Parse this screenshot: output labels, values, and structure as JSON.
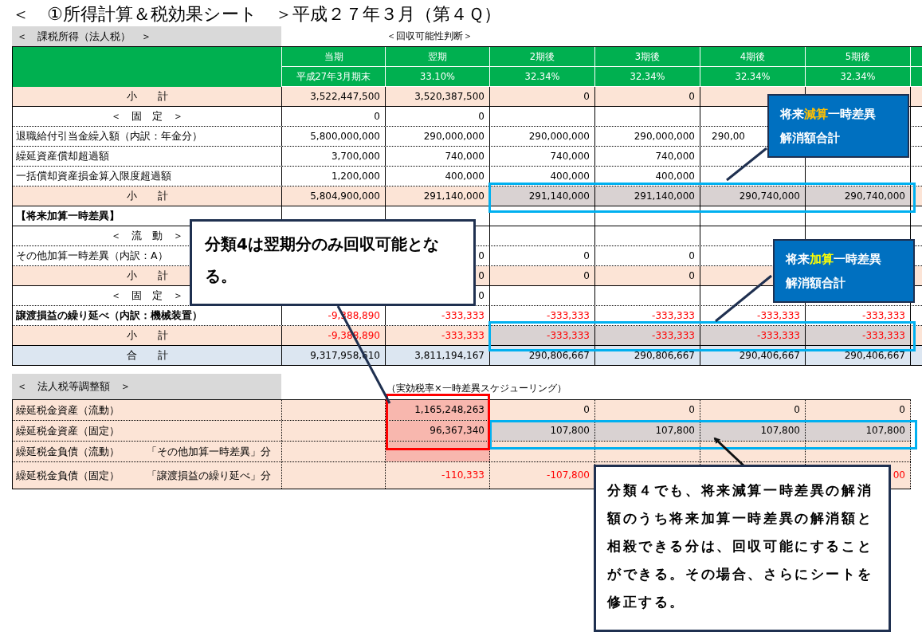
{
  "title": "＜　①所得計算＆税効果シート　＞平成２７年３月（第４Ｑ）",
  "upper": {
    "heading": "＜　課税所得（法人税）　＞",
    "note": "＜回収可能性判断＞",
    "columns": [
      {
        "period": "当期",
        "rate": "平成27年3月期末"
      },
      {
        "period": "翌期",
        "rate": "33.10%"
      },
      {
        "period": "2期後",
        "rate": "32.34%"
      },
      {
        "period": "3期後",
        "rate": "32.34%"
      },
      {
        "period": "4期後",
        "rate": "32.34%"
      },
      {
        "period": "5期後",
        "rate": "32.34%"
      }
    ],
    "rows": [
      {
        "kind": "subtotal",
        "label": "小　　計",
        "bold": false,
        "cells": [
          {
            "value": "3,522,447,500"
          },
          {
            "value": "3,520,387,500"
          },
          {
            "value": "0"
          },
          {
            "value": "0"
          },
          {},
          {}
        ]
      },
      {
        "kind": "group",
        "label": "＜　固　定　＞",
        "bold": false,
        "cells": [
          {
            "value": "0"
          },
          {
            "value": "0"
          },
          {},
          {},
          {},
          {}
        ]
      },
      {
        "kind": "item",
        "label": "退職給付引当金繰入額（内訳：年金分）",
        "bold": false,
        "cells": [
          {
            "value": "5,800,000,000"
          },
          {
            "value": "290,000,000"
          },
          {
            "value": "290,000,000"
          },
          {
            "value": "290,000,000"
          },
          {
            "value": "290,00",
            "cut": true
          },
          {}
        ]
      },
      {
        "kind": "item",
        "label": "繰延資産償却超過額",
        "bold": false,
        "cells": [
          {
            "value": "3,700,000"
          },
          {
            "value": "740,000"
          },
          {
            "value": "740,000"
          },
          {
            "value": "740,000"
          },
          {},
          {}
        ]
      },
      {
        "kind": "item",
        "label": "一括償却資産損金算入限度超過額",
        "bold": false,
        "cells": [
          {
            "value": "1,200,000"
          },
          {
            "value": "400,000"
          },
          {
            "value": "400,000"
          },
          {
            "value": "400,000"
          },
          {},
          {}
        ]
      },
      {
        "kind": "subtotal",
        "label": "小　　計",
        "bold": false,
        "cells": [
          {
            "value": "5,804,900,000"
          },
          {
            "value": "291,140,000"
          },
          {
            "value": "291,140,000",
            "shaded": true
          },
          {
            "value": "291,140,000",
            "shaded": true
          },
          {
            "value": "290,740,000",
            "shaded": true
          },
          {
            "value": "290,740,000",
            "shaded": true
          }
        ]
      },
      {
        "kind": "section",
        "label": "【将来加算一時差異】",
        "bold": true,
        "cells": [
          {},
          {},
          {},
          {},
          {},
          {}
        ]
      },
      {
        "kind": "group",
        "label": "＜　流　動　＞",
        "bold": false,
        "cells": [
          {},
          {},
          {},
          {},
          {},
          {}
        ]
      },
      {
        "kind": "item",
        "label": "その他加算一時差異（内訳：A）",
        "bold": false,
        "cells": [
          {},
          {
            "value": "0"
          },
          {
            "value": "0"
          },
          {
            "value": "0"
          },
          {},
          {}
        ]
      },
      {
        "kind": "subtotal",
        "label": "小　　計",
        "bold": false,
        "cells": [
          {},
          {
            "value": "0"
          },
          {
            "value": "0"
          },
          {
            "value": "0"
          },
          {},
          {}
        ]
      },
      {
        "kind": "group",
        "label": "＜　固　定　＞",
        "bold": false,
        "cells": [
          {},
          {
            "value": "0"
          },
          {},
          {},
          {},
          {}
        ]
      },
      {
        "kind": "item",
        "label": "譲渡損益の繰り延べ（内訳：機械装置）",
        "bold": true,
        "negative": true,
        "cells": [
          {
            "value": "-9,388,890"
          },
          {
            "value": "-333,333"
          },
          {
            "value": "-333,333"
          },
          {
            "value": "-333,333"
          },
          {
            "value": "-333,333"
          },
          {
            "value": "-333,333"
          }
        ]
      },
      {
        "kind": "subtotal",
        "label": "小　　計",
        "bold": false,
        "negative": true,
        "cells": [
          {
            "value": "-9,388,890"
          },
          {
            "value": "-333,333"
          },
          {
            "value": "-333,333",
            "shaded": true
          },
          {
            "value": "-333,333",
            "shaded": true
          },
          {
            "value": "-333,333",
            "shaded": true
          },
          {
            "value": "-333,333",
            "shaded": true
          }
        ]
      },
      {
        "kind": "total",
        "label": "合　　計",
        "bold": false,
        "cells": [
          {
            "value": "9,317,958,610"
          },
          {
            "value": "3,811,194,167"
          },
          {
            "value": "290,806,667"
          },
          {
            "value": "290,806,667"
          },
          {
            "value": "290,406,667"
          },
          {
            "value": "290,406,667"
          }
        ]
      }
    ]
  },
  "lower": {
    "heading": "＜　法人税等調整額　＞",
    "note": "（実効税率×一時差異スケジューリング）",
    "rows": [
      {
        "label": "繰延税金資産（流動）",
        "cells": [
          {},
          {
            "value": "1,165,248,263",
            "flagged": true
          },
          {
            "value": "0"
          },
          {
            "value": "0"
          },
          {
            "value": "0"
          },
          {
            "value": "0"
          }
        ]
      },
      {
        "label": "繰延税金資産（固定）",
        "cells": [
          {},
          {
            "value": "96,367,340",
            "flagged": true
          },
          {
            "value": "107,800",
            "shaded": true
          },
          {
            "value": "107,800",
            "shaded": true
          },
          {
            "value": "107,800",
            "shaded": true
          },
          {
            "value": "107,800",
            "shaded": true
          }
        ]
      },
      {
        "label": "繰延税金負債（流動）",
        "note": "「その他加算一時差異」分",
        "cells": [
          {},
          {
            "flagged": true
          },
          {},
          {},
          {},
          {}
        ]
      },
      {
        "label": "繰延税金負債（固定）",
        "note": "「譲渡損益の繰り延べ」分",
        "negative": true,
        "cells": [
          {},
          {
            "value": "-110,333"
          },
          {
            "value": "-107,800"
          },
          {},
          {},
          {
            "value": "00"
          }
        ]
      }
    ]
  },
  "callouts": [
    {
      "kind": "blue",
      "before": "将来",
      "accent": "減算",
      "after": "一時差異",
      "second_line": "解消額合計",
      "color": "#ffc000"
    },
    {
      "kind": "white",
      "text": "分類4は翌期分のみ回収可能となる。"
    },
    {
      "kind": "blue",
      "before": "将来",
      "accent": "加算",
      "after": "一時差異",
      "second_line": "解消額合計",
      "color": "#ffff00"
    },
    {
      "kind": "note",
      "text": "分類４でも、将来減算一時差異の解消額のうち将来加算一時差異の解消額と相殺できる分は、回収可能にすることができる。その場合、さらにシートを修正する。"
    }
  ]
}
